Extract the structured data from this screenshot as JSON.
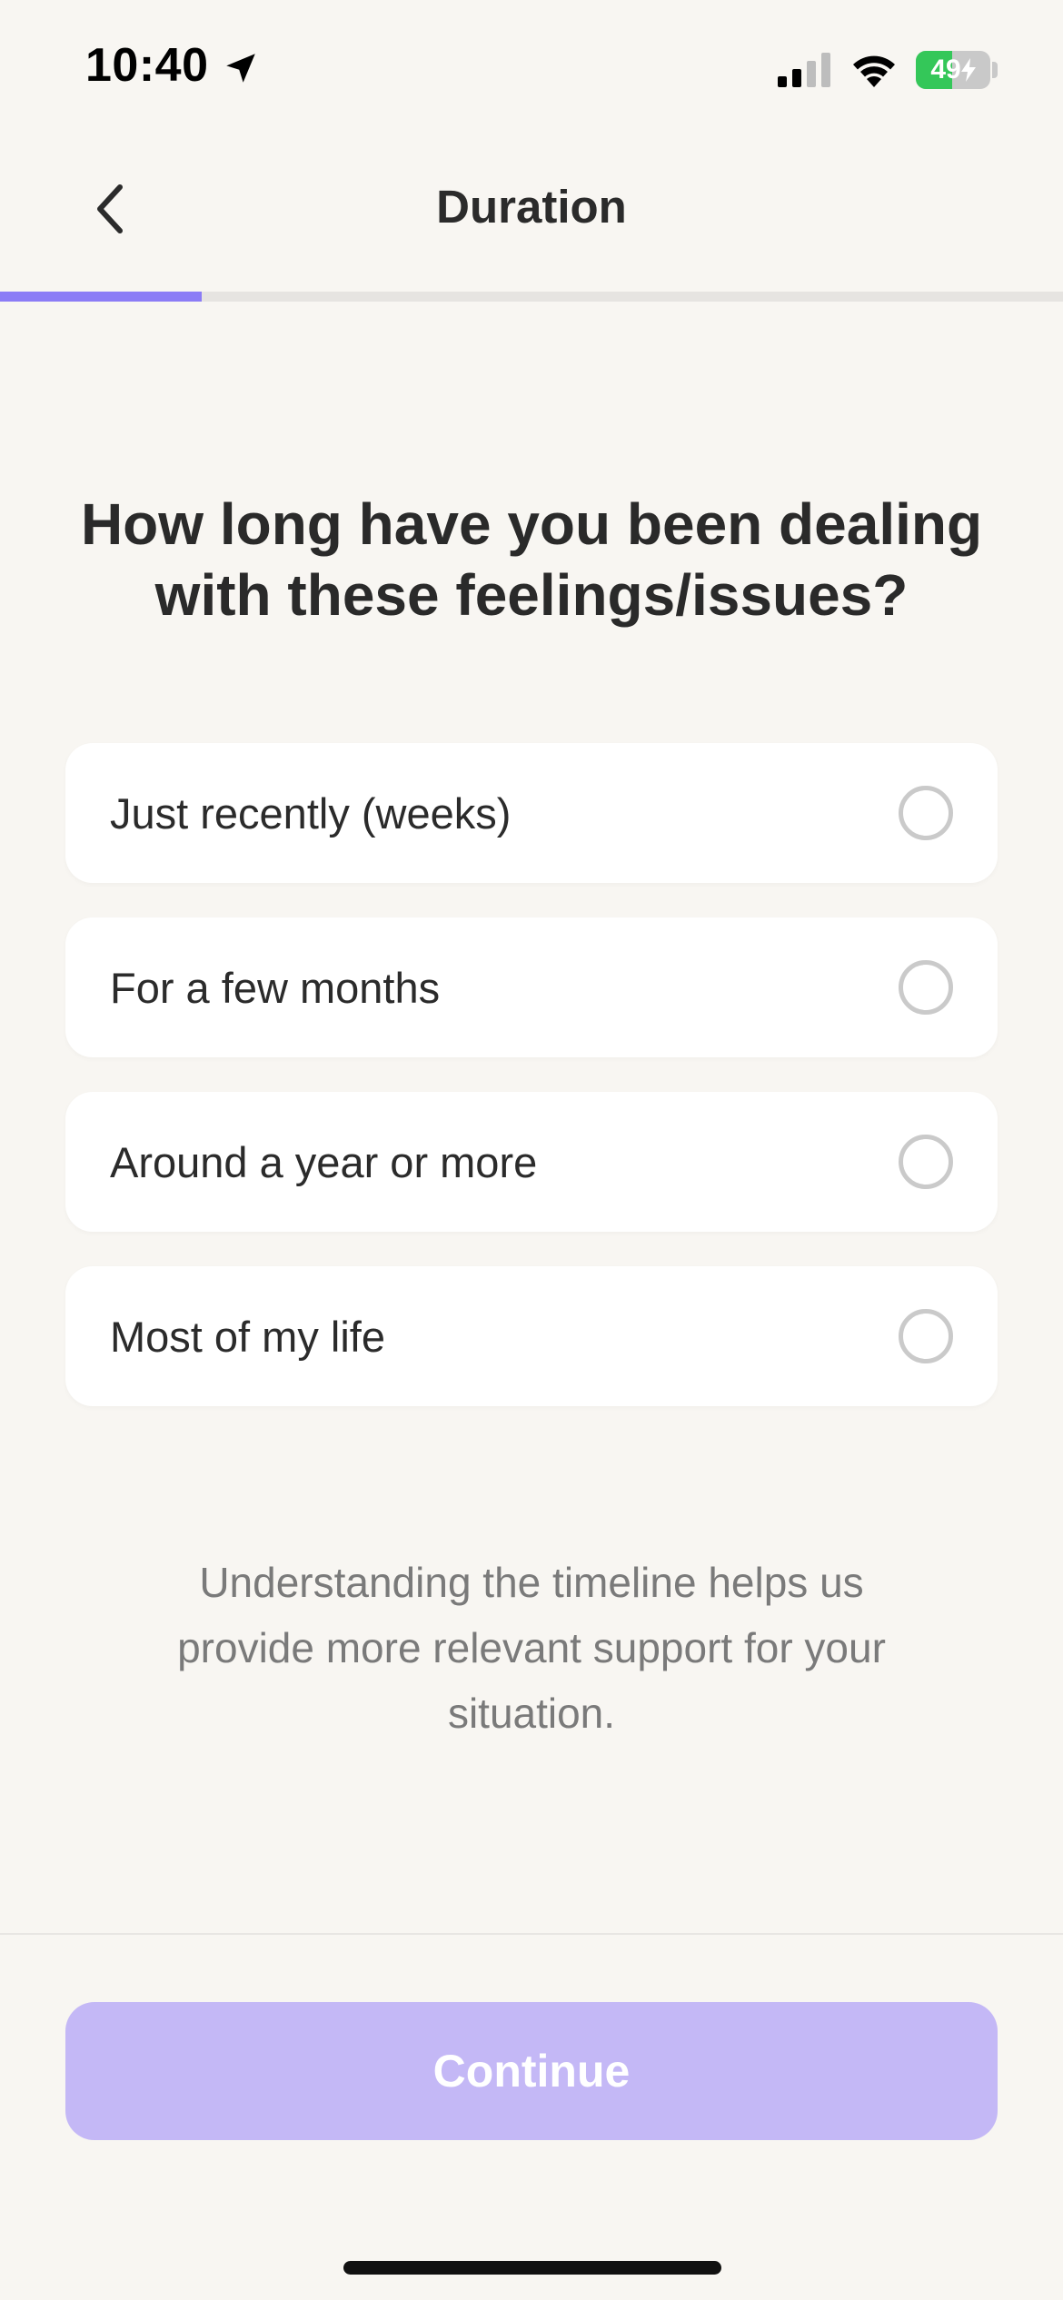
{
  "status_bar": {
    "time": "10:40",
    "battery_level": "49",
    "battery_fraction": 0.49,
    "location_icon": "location-arrow-icon",
    "signal_icon": "cellular-signal-icon",
    "wifi_icon": "wifi-icon",
    "charging_icon": "bolt-icon"
  },
  "nav": {
    "title": "Duration",
    "back_icon": "chevron-left-icon"
  },
  "progress": {
    "fraction": 0.19,
    "accent_color": "#8B7CF6"
  },
  "question": "How long have you been dealing with these feelings/issues?",
  "options": [
    {
      "label": "Just recently (weeks)",
      "selected": false
    },
    {
      "label": "For a few months",
      "selected": false
    },
    {
      "label": "Around a year or more",
      "selected": false
    },
    {
      "label": "Most of my life",
      "selected": false
    }
  ],
  "helper_text": "Understanding the timeline helps us provide more relevant support for your situation.",
  "continue_button": {
    "label": "Continue",
    "enabled": false,
    "color": "#C4B8F6"
  },
  "colors": {
    "background": "#F8F6F2",
    "card": "#FFFFFF",
    "battery_green": "#34C759"
  }
}
